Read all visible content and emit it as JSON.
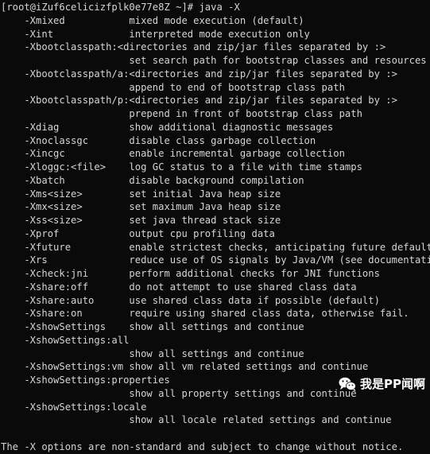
{
  "terminal": {
    "background_color": "#0a0a0a",
    "foreground_color": "#d5d5d5",
    "prompt": "[root@iZuf6celicizfplk0e77e8Z ~]# java -X",
    "lines": [
      "    -Xmixed           mixed mode execution (default)",
      "    -Xint             interpreted mode execution only",
      "    -Xbootclasspath:<directories and zip/jar files separated by :>",
      "                      set search path for bootstrap classes and resources",
      "    -Xbootclasspath/a:<directories and zip/jar files separated by :>",
      "                      append to end of bootstrap class path",
      "    -Xbootclasspath/p:<directories and zip/jar files separated by :>",
      "                      prepend in front of bootstrap class path",
      "    -Xdiag            show additional diagnostic messages",
      "    -Xnoclassgc       disable class garbage collection",
      "    -Xincgc           enable incremental garbage collection",
      "    -Xloggc:<file>    log GC status to a file with time stamps",
      "    -Xbatch           disable background compilation",
      "    -Xms<size>        set initial Java heap size",
      "    -Xmx<size>        set maximum Java heap size",
      "    -Xss<size>        set java thread stack size",
      "    -Xprof            output cpu profiling data",
      "    -Xfuture          enable strictest checks, anticipating future default",
      "    -Xrs              reduce use of OS signals by Java/VM (see documentation)",
      "    -Xcheck:jni       perform additional checks for JNI functions",
      "    -Xshare:off       do not attempt to use shared class data",
      "    -Xshare:auto      use shared class data if possible (default)",
      "    -Xshare:on        require using shared class data, otherwise fail.",
      "    -XshowSettings    show all settings and continue",
      "    -XshowSettings:all",
      "                      show all settings and continue",
      "    -XshowSettings:vm show all vm related settings and continue",
      "    -XshowSettings:properties",
      "                      show all property settings and continue",
      "    -XshowSettings:locale",
      "                      show all locale related settings and continue",
      "",
      "The -X options are non-standard and subject to change without notice."
    ]
  },
  "watermark": {
    "icon": "wechat-icon",
    "text": "我是PP闻啊",
    "color": "#ffffff"
  }
}
